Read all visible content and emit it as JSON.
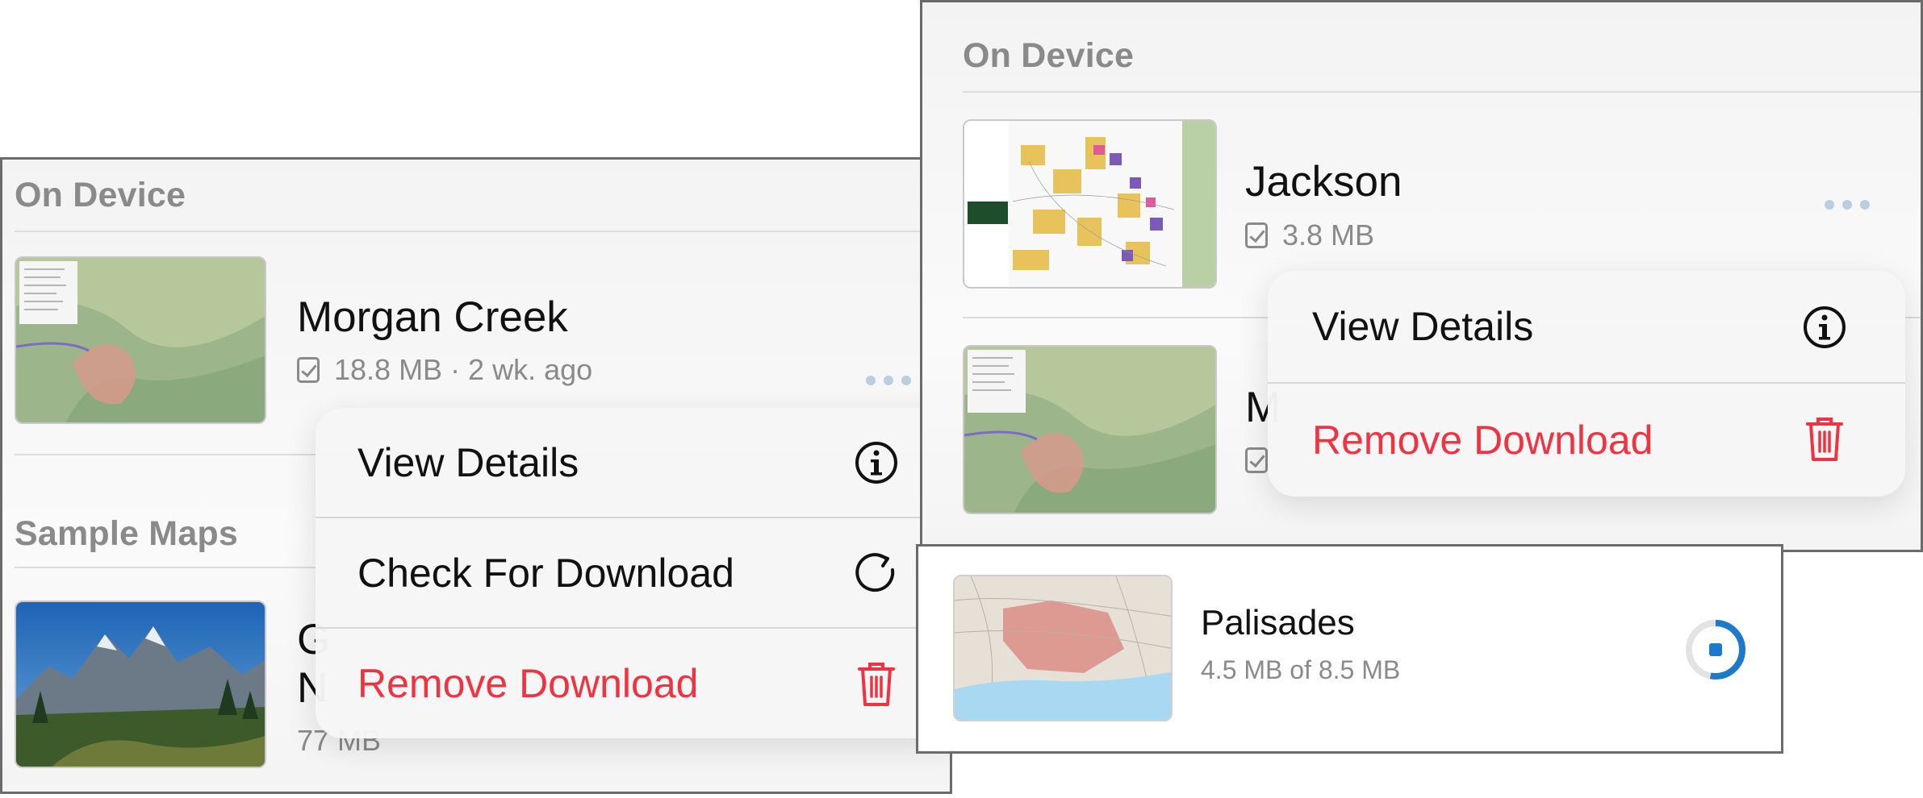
{
  "left_panel": {
    "on_device_title": "On Device",
    "map_title": "Morgan Creek",
    "map_meta": "18.8 MB · 2 wk. ago",
    "sample_title": "Sample Maps",
    "sample_line1": "G",
    "sample_line2": "N",
    "sample_size": "77 MB",
    "menu": {
      "view_details": "View Details",
      "check_download": "Check For Download",
      "remove_download": "Remove Download"
    }
  },
  "right_panel": {
    "on_device_title": "On Device",
    "map_title": "Jackson",
    "map_meta": "3.8 MB",
    "second_title_partial": "M",
    "menu": {
      "view_details": "View Details",
      "remove_download": "Remove Download"
    }
  },
  "bottom_panel": {
    "map_title": "Palisades",
    "progress_text": "4.5 MB of 8.5 MB",
    "progress_fraction": 0.53
  },
  "colors": {
    "danger": "#ef3340",
    "accent": "#1b7bc9",
    "secondary_text": "#8a8a8a"
  }
}
